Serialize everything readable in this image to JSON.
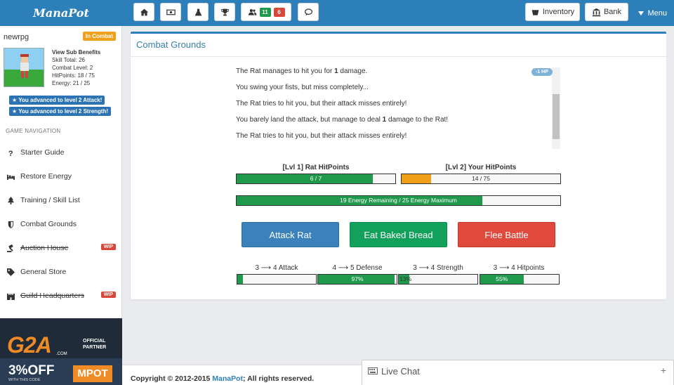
{
  "app": {
    "brand": "ManaPot"
  },
  "topbar": {
    "icons": [
      "home-icon",
      "money-icon",
      "flask-icon",
      "trophy-icon",
      "users-icon",
      "chat-bubble-icon"
    ],
    "online_count": "11",
    "alert_count": "6",
    "inventory_label": "Inventory",
    "bank_label": "Bank",
    "menu_label": "Menu"
  },
  "player": {
    "name": "newrpg",
    "status": "In Combat",
    "view_sub_benefits": "View Sub Benefits",
    "skill_total": "Skill Total: 26",
    "combat_level": "Combat Level: 2",
    "hitpoints": "HitPoints: 18 / 75",
    "energy": "Energy: 21 / 25",
    "advances": [
      "You advanced to level 2 Attack!",
      "You advanced to level 2 Strength!"
    ]
  },
  "nav": {
    "header": "GAME NAVIGATION",
    "items": [
      {
        "label": "Starter Guide",
        "icon": "question-icon",
        "wip": false
      },
      {
        "label": "Restore Energy",
        "icon": "bed-icon",
        "wip": false
      },
      {
        "label": "Training / Skill List",
        "icon": "tree-icon",
        "wip": false
      },
      {
        "label": "Combat Grounds",
        "icon": "shield-icon",
        "wip": false
      },
      {
        "label": "Auction House",
        "icon": "gavel-icon",
        "wip": true
      },
      {
        "label": "General Store",
        "icon": "tag-icon",
        "wip": false
      },
      {
        "label": "Guild Headquarters",
        "icon": "castle-icon",
        "wip": true
      }
    ],
    "wip_label": "WIP"
  },
  "ad": {
    "logo": "G2A",
    "logo_sub": ".COM",
    "partner": "OFFICIAL PARTNER",
    "discount": "3%OFF",
    "discount_sub": "WITH THIS CODE",
    "code": "MPOT"
  },
  "combat": {
    "title": "Combat Grounds",
    "hp_change": "-1 HP",
    "log": [
      {
        "pre": "The Rat manages to hit you for ",
        "num": "1",
        "post": " damage."
      },
      {
        "pre": "You swing your fists, but miss completely...",
        "num": "",
        "post": ""
      },
      {
        "pre": "The Rat tries to hit you, but their attack misses entirely!",
        "num": "",
        "post": ""
      },
      {
        "pre": "You barely land the attack, but manage to deal ",
        "num": "1",
        "post": " damage to the Rat!"
      },
      {
        "pre": "The Rat tries to hit you, but their attack misses entirely!",
        "num": "",
        "post": ""
      }
    ],
    "enemy_hp_label": "[Lvl 1] Rat HitPoints",
    "enemy_hp_text": "6 / 7",
    "enemy_hp_fraction": 0.857,
    "player_hp_label": "[Lvl 2] Your HitPoints",
    "player_hp_text": "14 / 75",
    "player_hp_fraction": 0.187,
    "energy_text": "19 Energy Remaining / 25 Energy Maximum",
    "energy_fraction": 0.76,
    "actions": {
      "attack": "Attack Rat",
      "eat": "Eat Baked Bread",
      "flee": "Flee Battle"
    },
    "skills": [
      {
        "from": "3",
        "to": "4",
        "name": "Attack",
        "text": "",
        "fraction": 0.07
      },
      {
        "from": "4",
        "to": "5",
        "name": "Defense",
        "text": "97%",
        "fraction": 0.97
      },
      {
        "from": "3",
        "to": "4",
        "name": "Strength",
        "text": "13%",
        "fraction": 0.13
      },
      {
        "from": "3",
        "to": "4",
        "name": "Hitpoints",
        "text": "55%",
        "fraction": 0.55
      }
    ]
  },
  "colors": {
    "primary": "#2c7fb8",
    "green": "#1f9a4d",
    "orange": "#f0a01a",
    "red": "#d9463a",
    "attack_button": "#3b82bd",
    "eat_button": "#12a15a",
    "flee_button": "#df4a3c"
  },
  "footer": {
    "copyright_pre": "Copyright © 2012-2015 ",
    "copyright_brand": "ManaPot",
    "copyright_post": "; All rights reserved."
  },
  "chat": {
    "title": "Live Chat",
    "expand": "+"
  }
}
